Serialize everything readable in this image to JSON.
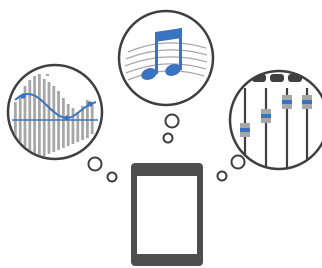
{
  "illustration": {
    "bubbles": [
      {
        "id": "chart-bubble",
        "icon": "equalizer-chart-icon"
      },
      {
        "id": "music-bubble",
        "icon": "music-note-icon"
      },
      {
        "id": "mixer-bubble",
        "icon": "mixer-sliders-icon"
      }
    ],
    "device": {
      "icon": "smartphone-icon"
    }
  },
  "colors": {
    "outline": "#3f3f3f",
    "gray_bar": "#a7a7a7",
    "accent_blue": "#3a74c0",
    "device_body": "#4e4e4e",
    "screen": "#ffffff"
  }
}
